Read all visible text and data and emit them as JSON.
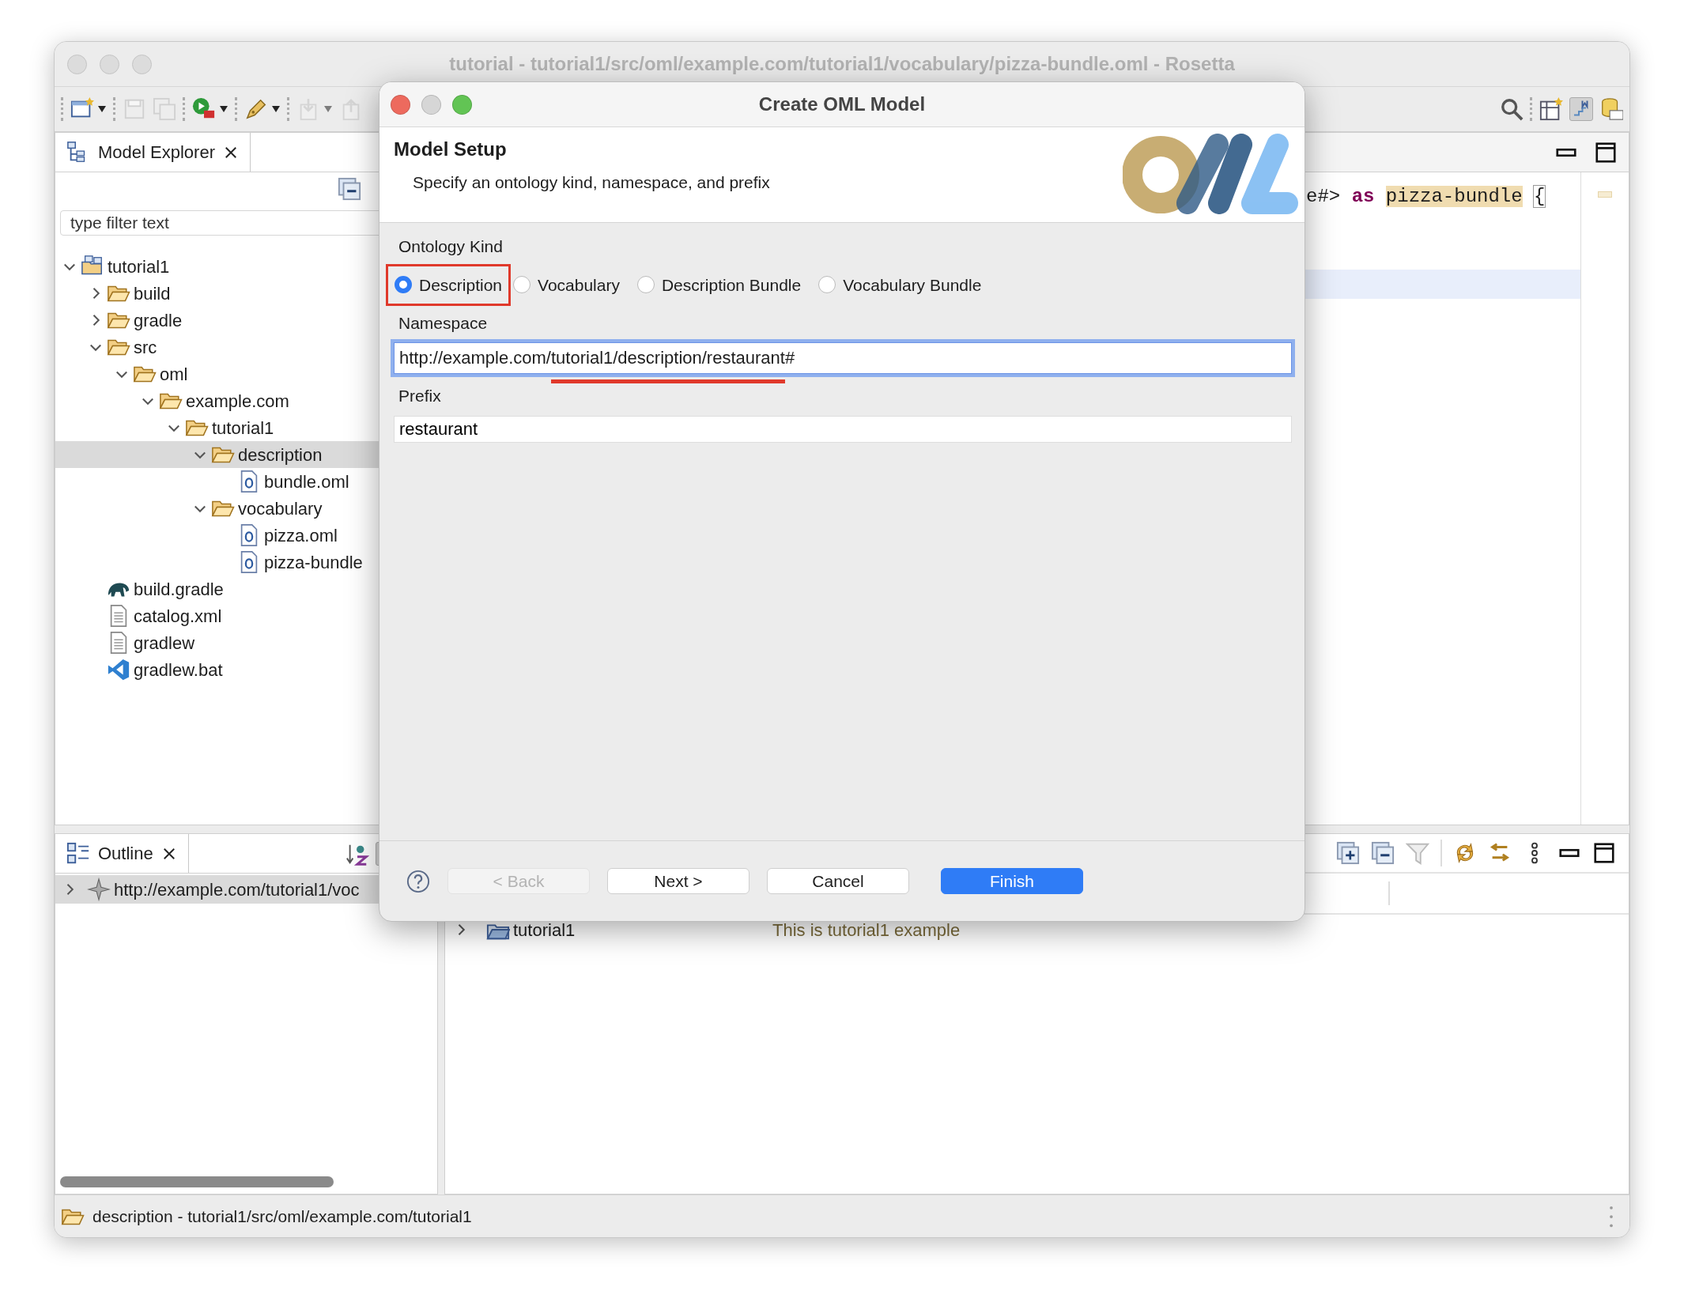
{
  "window": {
    "title": "tutorial - tutorial1/src/oml/example.com/tutorial1/vocabulary/pizza-bundle.oml - Rosetta",
    "active": false
  },
  "toolbar": {
    "left": [
      {
        "disabled": false,
        "dropdown": true
      },
      {
        "disabled": true,
        "dropdown": false
      },
      {
        "disabled": true,
        "dropdown": false
      },
      {
        "disabled": false,
        "dropdown": true
      },
      {
        "disabled": false,
        "dropdown": true
      },
      {
        "disabled": true,
        "dropdown": true
      },
      {
        "disabled": true,
        "dropdown": false
      }
    ],
    "right": [
      {
        "pressed": false
      },
      {
        "pressed": false
      },
      {
        "pressed": true
      },
      {
        "pressed": false
      }
    ]
  },
  "model_explorer": {
    "tab": "Model Explorer",
    "filter": {
      "placeholder": "type filter text"
    },
    "tree": [
      {
        "label": "tutorial1",
        "kind": "project",
        "expanded": true,
        "selected": false,
        "children": [
          {
            "label": "build",
            "kind": "folder",
            "expanded": false,
            "selected": false
          },
          {
            "label": "gradle",
            "kind": "folder",
            "expanded": false,
            "selected": false
          },
          {
            "label": "src",
            "kind": "folder",
            "expanded": true,
            "selected": false,
            "children": [
              {
                "label": "oml",
                "kind": "folder",
                "expanded": true,
                "selected": false,
                "children": [
                  {
                    "label": "example.com",
                    "kind": "folder",
                    "expanded": true,
                    "selected": false,
                    "children": [
                      {
                        "label": "tutorial1",
                        "kind": "folder",
                        "expanded": true,
                        "selected": false,
                        "children": [
                          {
                            "label": "description",
                            "kind": "folder",
                            "expanded": true,
                            "selected": true,
                            "children": [
                              {
                                "label": "bundle.oml",
                                "kind": "oml",
                                "selected": false
                              }
                            ]
                          },
                          {
                            "label": "vocabulary",
                            "kind": "folder",
                            "expanded": true,
                            "selected": false,
                            "children": [
                              {
                                "label": "pizza.oml",
                                "kind": "oml",
                                "selected": false
                              },
                              {
                                "label": "pizza-bundle",
                                "kind": "oml",
                                "selected": false
                              }
                            ]
                          }
                        ]
                      }
                    ]
                  }
                ]
              }
            ]
          },
          {
            "label": "build.gradle",
            "kind": "gradle",
            "selected": false
          },
          {
            "label": "catalog.xml",
            "kind": "text",
            "selected": false
          },
          {
            "label": "gradlew",
            "kind": "text",
            "selected": false
          },
          {
            "label": "gradlew.bat",
            "kind": "script",
            "selected": false
          }
        ]
      }
    ]
  },
  "outline": {
    "tab": "Outline",
    "rows": [
      {
        "label": "http://example.com/tutorial1/voc",
        "expanded": false,
        "selected": true
      }
    ]
  },
  "editor": {
    "lines": [
      {
        "current": false,
        "tokens": [
          {
            "text": "e#>",
            "kind": "plain"
          },
          {
            "text": "as",
            "kind": "keyword"
          },
          {
            "text": "pizza-bundle",
            "kind": "highlight"
          },
          {
            "text": "{",
            "kind": "bracket"
          }
        ]
      },
      {
        "current": false
      },
      {
        "current": false
      },
      {
        "current": true
      }
    ]
  },
  "bottom_panel": {
    "rows": [
      {
        "name": "tutorial1",
        "description": "This is tutorial1 example",
        "expanded": false
      }
    ]
  },
  "status_bar": {
    "text": "description - tutorial1/src/oml/example.com/tutorial1"
  },
  "dialog": {
    "title": "Create OML Model",
    "heading": "Model Setup",
    "subtitle": "Specify an ontology kind, namespace, and prefix",
    "ontology_kind": {
      "label": "Ontology Kind",
      "options": [
        {
          "label": "Description",
          "selected": true,
          "annotated": true
        },
        {
          "label": "Vocabulary",
          "selected": false,
          "annotated": false
        },
        {
          "label": "Description Bundle",
          "selected": false,
          "annotated": false
        },
        {
          "label": "Vocabulary Bundle",
          "selected": false,
          "annotated": false
        }
      ]
    },
    "namespace": {
      "label": "Namespace",
      "focused": true,
      "parts": [
        {
          "text": "http://example.com/",
          "marked": false
        },
        {
          "text": "tutorial1/description/restaurant",
          "marked": true
        },
        {
          "text": "#",
          "marked": false
        }
      ]
    },
    "prefix": {
      "label": "Prefix",
      "value": "restaurant"
    },
    "buttons": [
      {
        "label": "< Back",
        "disabled": true,
        "primary": false
      },
      {
        "label": "Next >",
        "disabled": false,
        "primary": false
      },
      {
        "label": "Cancel",
        "disabled": false,
        "primary": false
      },
      {
        "label": "Finish",
        "disabled": false,
        "primary": true
      }
    ]
  }
}
